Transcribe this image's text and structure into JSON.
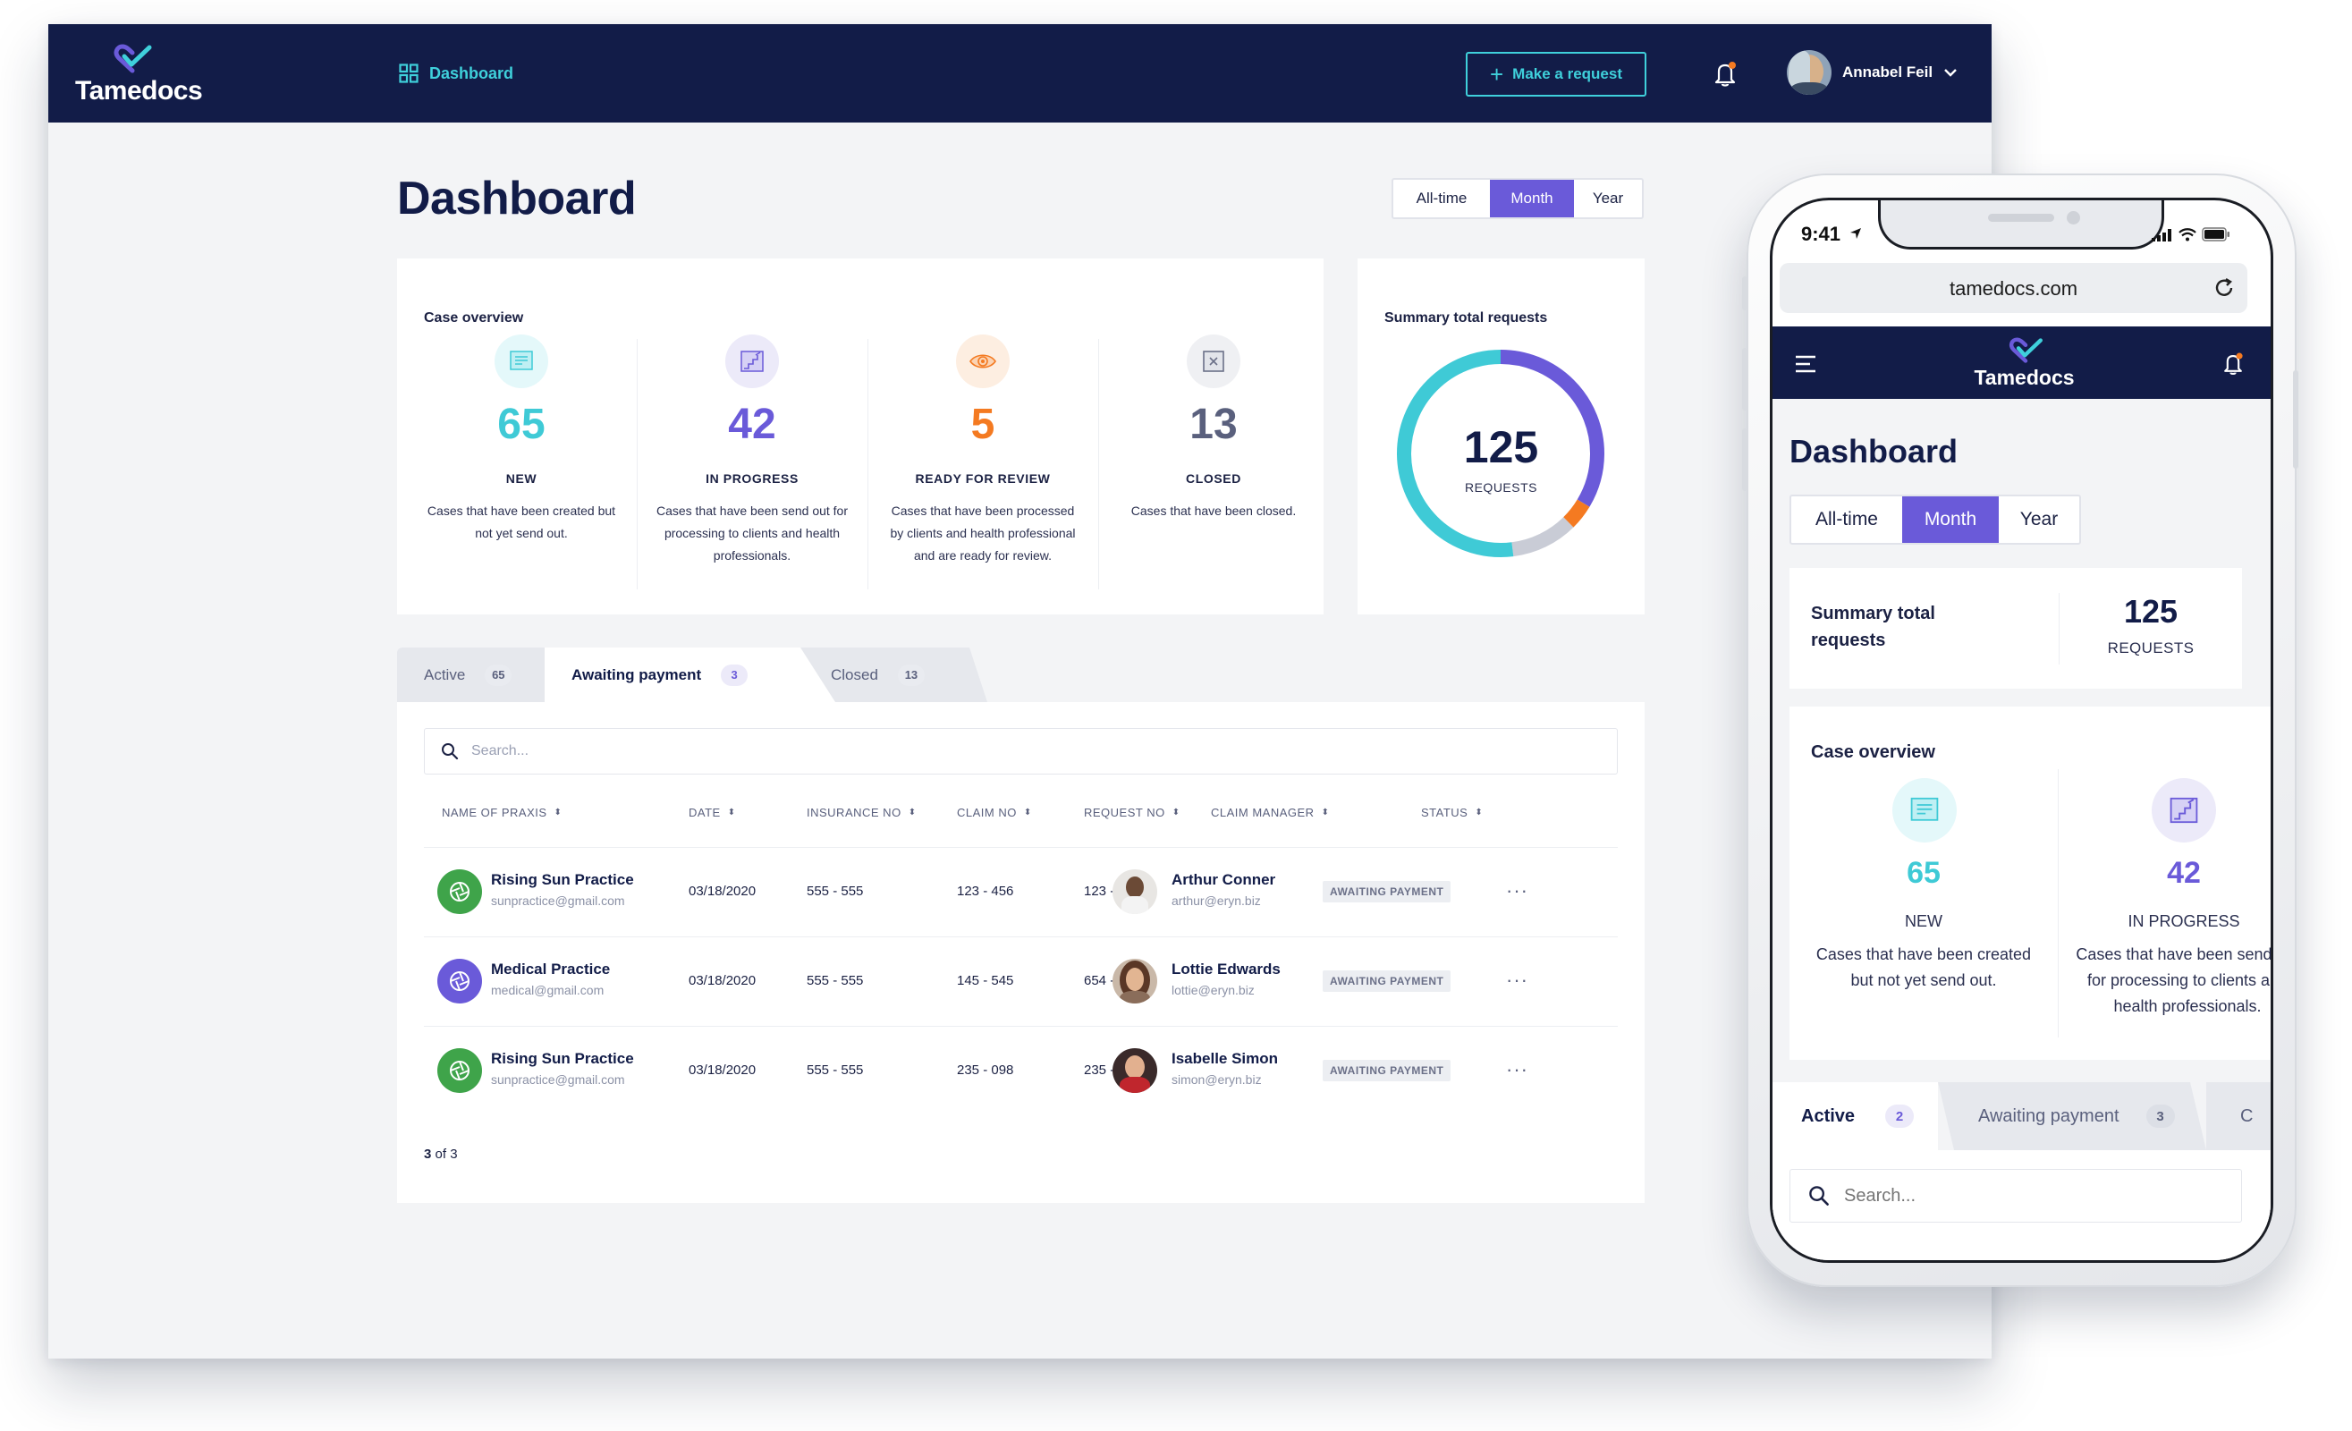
{
  "desktop": {
    "brand": "Tamedocs",
    "nav": {
      "dashboard_label": "Dashboard"
    },
    "make_request_label": "Make a request",
    "user_name": "Annabel Feil",
    "page_title": "Dashboard",
    "period": {
      "options": [
        "All-time",
        "Month",
        "Year"
      ],
      "selected": "Month"
    },
    "case_overview": {
      "title": "Case overview",
      "stats": [
        {
          "value": "65",
          "label": "NEW",
          "description": "Cases that have been created but not yet send out.",
          "color": "#3fcad6"
        },
        {
          "value": "42",
          "label": "IN PROGRESS",
          "description": "Cases that have been send out for processing to clients and health professionals.",
          "color": "#6a5ad9"
        },
        {
          "value": "5",
          "label": "READY FOR REVIEW",
          "description": "Cases that have been processed by clients and health professional and are ready for review.",
          "color": "#f47a21"
        },
        {
          "value": "13",
          "label": "CLOSED",
          "description": "Cases that have been closed.",
          "color": "#5a607d"
        }
      ]
    },
    "summary": {
      "title": "Summary total requests",
      "total": "125",
      "unit": "REQUESTS",
      "donut_segments": [
        {
          "category": "in_progress",
          "value": 42,
          "color": "#6a5ad9"
        },
        {
          "category": "ready_for_review",
          "value": 5,
          "color": "#f47a21"
        },
        {
          "category": "closed",
          "value": 13,
          "color": "#c9ccd6"
        },
        {
          "category": "new",
          "value": 65,
          "color": "#3fcad6"
        }
      ]
    },
    "tabs": [
      {
        "label": "Active",
        "count": "65"
      },
      {
        "label": "Awaiting payment",
        "count": "3"
      },
      {
        "label": "Closed",
        "count": "13"
      }
    ],
    "active_tab": "Awaiting payment",
    "search_placeholder": "Search...",
    "table": {
      "headers": [
        "NAME OF PRAXIS",
        "DATE",
        "INSURANCE NO",
        "CLAIM NO",
        "REQUEST NO",
        "CLAIM MANAGER",
        "STATUS"
      ],
      "rows": [
        {
          "praxis": "Rising Sun Practice",
          "praxis_email": "sunpractice@gmail.com",
          "praxis_color": "#3fa44a",
          "date": "03/18/2020",
          "insurance": "555 - 555",
          "claim": "123 - 456",
          "request": "123 - 456",
          "manager": "Arthur Conner",
          "manager_email": "arthur@eryn.biz",
          "status": "AWAITING PAYMENT"
        },
        {
          "praxis": "Medical Practice",
          "praxis_email": "medical@gmail.com",
          "praxis_color": "#6a5ad9",
          "date": "03/18/2020",
          "insurance": "555 - 555",
          "claim": "145 - 545",
          "request": "654 - 545",
          "manager": "Lottie Edwards",
          "manager_email": "lottie@eryn.biz",
          "status": "AWAITING PAYMENT"
        },
        {
          "praxis": "Rising Sun Practice",
          "praxis_email": "sunpractice@gmail.com",
          "praxis_color": "#3fa44a",
          "date": "03/18/2020",
          "insurance": "555 - 555",
          "claim": "235 - 098",
          "request": "235 - 764",
          "manager": "Isabelle Simon",
          "manager_email": "simon@eryn.biz",
          "status": "AWAITING PAYMENT"
        }
      ]
    },
    "pagination_current": "3",
    "pagination_text": "of 3"
  },
  "phone": {
    "time": "9:41",
    "url": "tamedocs.com",
    "brand": "Tamedocs",
    "page_title": "Dashboard",
    "period": {
      "options": [
        "All-time",
        "Month",
        "Year"
      ],
      "selected": "Month"
    },
    "summary": {
      "title_line1": "Summary total",
      "title_line2": "requests",
      "total": "125",
      "unit": "REQUESTS"
    },
    "case_overview": {
      "title": "Case overview",
      "stats": [
        {
          "value": "65",
          "label": "NEW",
          "description": "Cases that have been created but not yet send out."
        },
        {
          "value": "42",
          "label": "IN PROGRESS",
          "description": "Cases that have been send out for processing to clients and health professionals."
        }
      ]
    },
    "tabs": [
      {
        "label": "Active",
        "count": "2"
      },
      {
        "label": "Awaiting payment",
        "count": "3"
      },
      {
        "label": "C",
        "count": ""
      }
    ],
    "search_placeholder": "Search..."
  },
  "colors": {
    "navy": "#121c48",
    "teal": "#3fd0db",
    "purple": "#6a5ad9",
    "orange": "#f47a21"
  }
}
